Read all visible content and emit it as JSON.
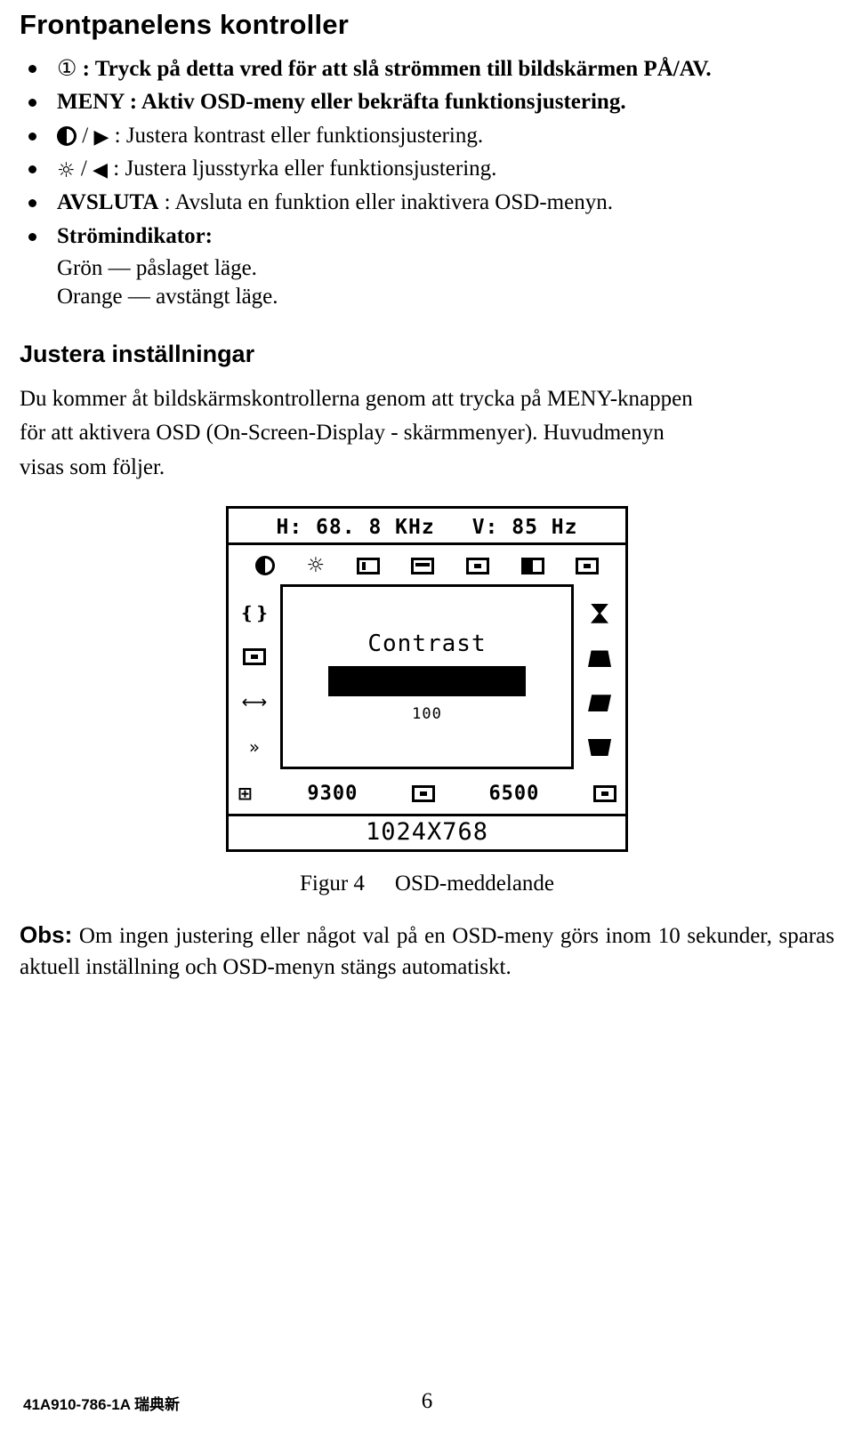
{
  "heading": "Frontpanelens kontroller",
  "bullets": [
    {
      "icon": "power-circle-icon",
      "icon_glyph": "①",
      "text": ": Tryck på detta vred för att slå strömmen till bildskärmen PÅ/AV.",
      "bold": true
    },
    {
      "icon": "menu-label",
      "label": "MENY",
      "text": " : Aktiv OSD-meny eller bekräfta funktionsjustering.",
      "bold": true
    },
    {
      "icon": "contrast-icon",
      "icon_glyph": "◐",
      "sep": "/",
      "icon2": "triangle-right-icon",
      "icon2_glyph": "▶",
      "text": " : Justera kontrast eller funktionsjustering.",
      "bold": false
    },
    {
      "icon": "brightness-icon",
      "icon_glyph": "☼",
      "sep": "/",
      "icon2": "triangle-left-icon",
      "icon2_glyph": "◀",
      "text": " : Justera ljusstyrka eller funktionsjustering.",
      "bold": false
    },
    {
      "icon": "exit-label",
      "label": "AVSLUTA",
      "text": " : Avsluta en funktion eller inaktivera OSD-menyn.",
      "bold": true
    },
    {
      "icon": "power-indicator-label",
      "label": "Strömindikator:",
      "text": "",
      "bold": true
    }
  ],
  "indicator_lines": [
    "Grön —  påslaget läge.",
    "Orange — avstängt läge."
  ],
  "section2": {
    "title": "Justera inställningar",
    "paragraph_line1": "Du kommer åt bildskärmskontrollerna genom att trycka på MENY-knappen",
    "paragraph_line2": "för att aktivera OSD (On-Screen-Display - skärmmenyer). Huvudmenyn",
    "paragraph_line3": "visas som följer."
  },
  "osd": {
    "h_freq": "H: 68. 8 KHz",
    "v_freq": "V: 85 Hz",
    "top_icons": [
      "contrast-icon",
      "brightness-icon",
      "h-position-icon",
      "h-size-icon",
      "v-position-icon",
      "v-size-icon",
      "zoom-icon"
    ],
    "left_icons": [
      "degauss-icon",
      "moire-icon",
      "h-arrow-icon",
      "more-icon"
    ],
    "right_icons": [
      "pincushion-icon",
      "trapezoid-icon",
      "parallelogram-icon",
      "rotation-icon"
    ],
    "center_label": "Contrast",
    "center_value": "100",
    "bottom_left_label": "9300",
    "bottom_right_label": "6500",
    "resolution": "1024X768"
  },
  "figure": {
    "caption_number": "Figur 4",
    "caption_text": "OSD-meddelande"
  },
  "note": {
    "lead": "Obs:",
    "text": " Om ingen justering eller något val på en OSD-meny görs inom 10 sekunder, sparas aktuell inställning och OSD-menyn stängs automatiskt."
  },
  "footer": {
    "doc_id": "41A910-786-1A 瑞典新",
    "page_number": "6"
  }
}
